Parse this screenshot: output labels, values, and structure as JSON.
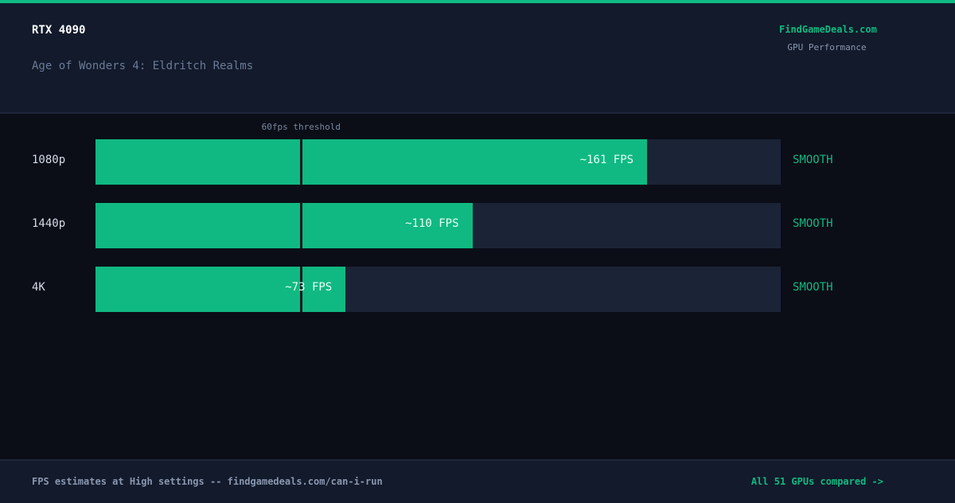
{
  "header": {
    "gpu": "RTX 4090",
    "game": "Age of Wonders 4: Eldritch Realms",
    "brand": "FindGameDeals.com",
    "brand_sub": "GPU Performance"
  },
  "chart_data": {
    "type": "bar",
    "orientation": "horizontal",
    "categories": [
      "1080p",
      "1440p",
      "4K"
    ],
    "values": [
      161,
      110,
      73
    ],
    "value_labels": [
      "~161 FPS",
      "~110 FPS",
      "~73 FPS"
    ],
    "status_labels": [
      "SMOOTH",
      "SMOOTH",
      "SMOOTH"
    ],
    "xlim": [
      0,
      200
    ],
    "threshold": {
      "value": 60,
      "label": "60fps threshold"
    },
    "bar_color": "#10b981",
    "track_color": "#1b2336",
    "status_color": "#10b981"
  },
  "footer": {
    "note": "FPS estimates at High settings -- findgamedeals.com/can-i-run",
    "link": "All 51 GPUs compared ->"
  }
}
